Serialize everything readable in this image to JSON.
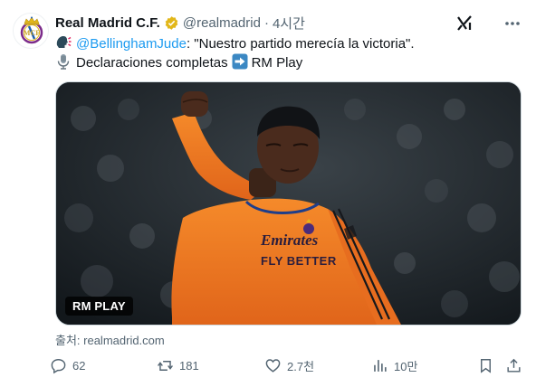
{
  "tweet": {
    "author_name": "Real Madrid C.F.",
    "handle": "@realmadrid",
    "separator": "·",
    "time": "4시간",
    "line1": {
      "emoji_icon": "speaking-head-icon",
      "mention": "@BellinghamJude",
      "quote": ": \"Nuestro partido merecía la victoria\"."
    },
    "line2": {
      "emoji_icon": "microphone-icon",
      "text": "Declaraciones completas",
      "arrow_icon": "right-arrow-icon",
      "link_text": "RM Play"
    },
    "media_label": "RM PLAY",
    "source": "출처: realmadrid.com",
    "stats": {
      "replies": "62",
      "reposts": "181",
      "likes": "2.7천",
      "views": "10만"
    }
  },
  "colors": {
    "accent": "#1d9bf0",
    "verified_gold": "#e2b719",
    "muted": "#536471",
    "kit_orange": "#f07a1e"
  }
}
